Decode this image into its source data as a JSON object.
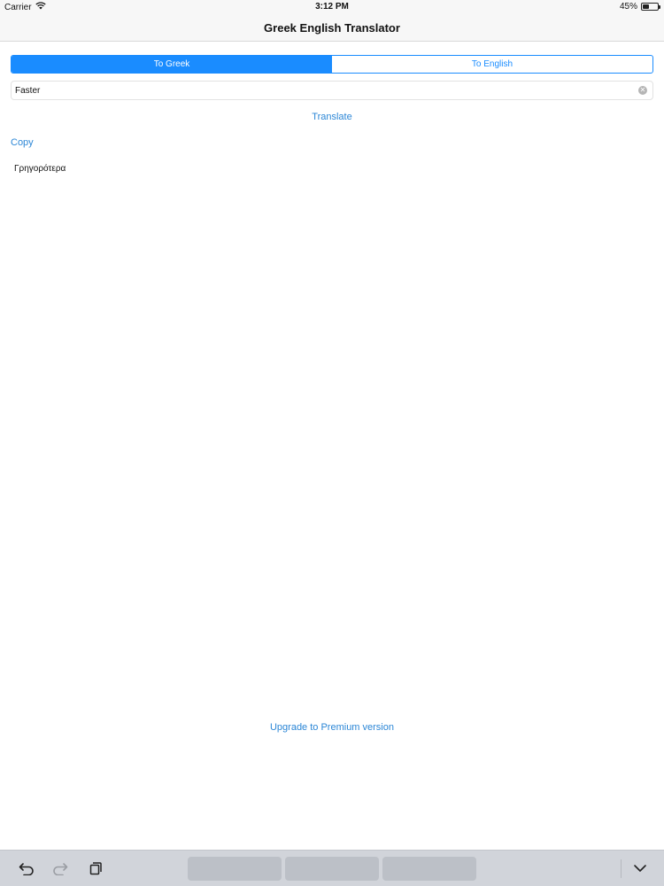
{
  "status_bar": {
    "carrier": "Carrier",
    "time": "3:12 PM",
    "battery_percent": "45%",
    "battery_level": 0.45
  },
  "nav": {
    "title": "Greek English Translator"
  },
  "segmented": {
    "options": [
      "To Greek",
      "To English"
    ],
    "selected_index": 0
  },
  "input": {
    "value": "Faster"
  },
  "actions": {
    "translate_label": "Translate",
    "copy_label": "Copy",
    "upgrade_label": "Upgrade to Premium version"
  },
  "result": {
    "text": "Γρηγορότερα"
  },
  "colors": {
    "accent": "#1a8cff",
    "link": "#2b86d6"
  },
  "keyboard_bar": {
    "icons": [
      "undo-icon",
      "redo-icon",
      "paste-icon",
      "dismiss-keyboard-icon"
    ],
    "suggestions": [
      "",
      "",
      ""
    ]
  }
}
